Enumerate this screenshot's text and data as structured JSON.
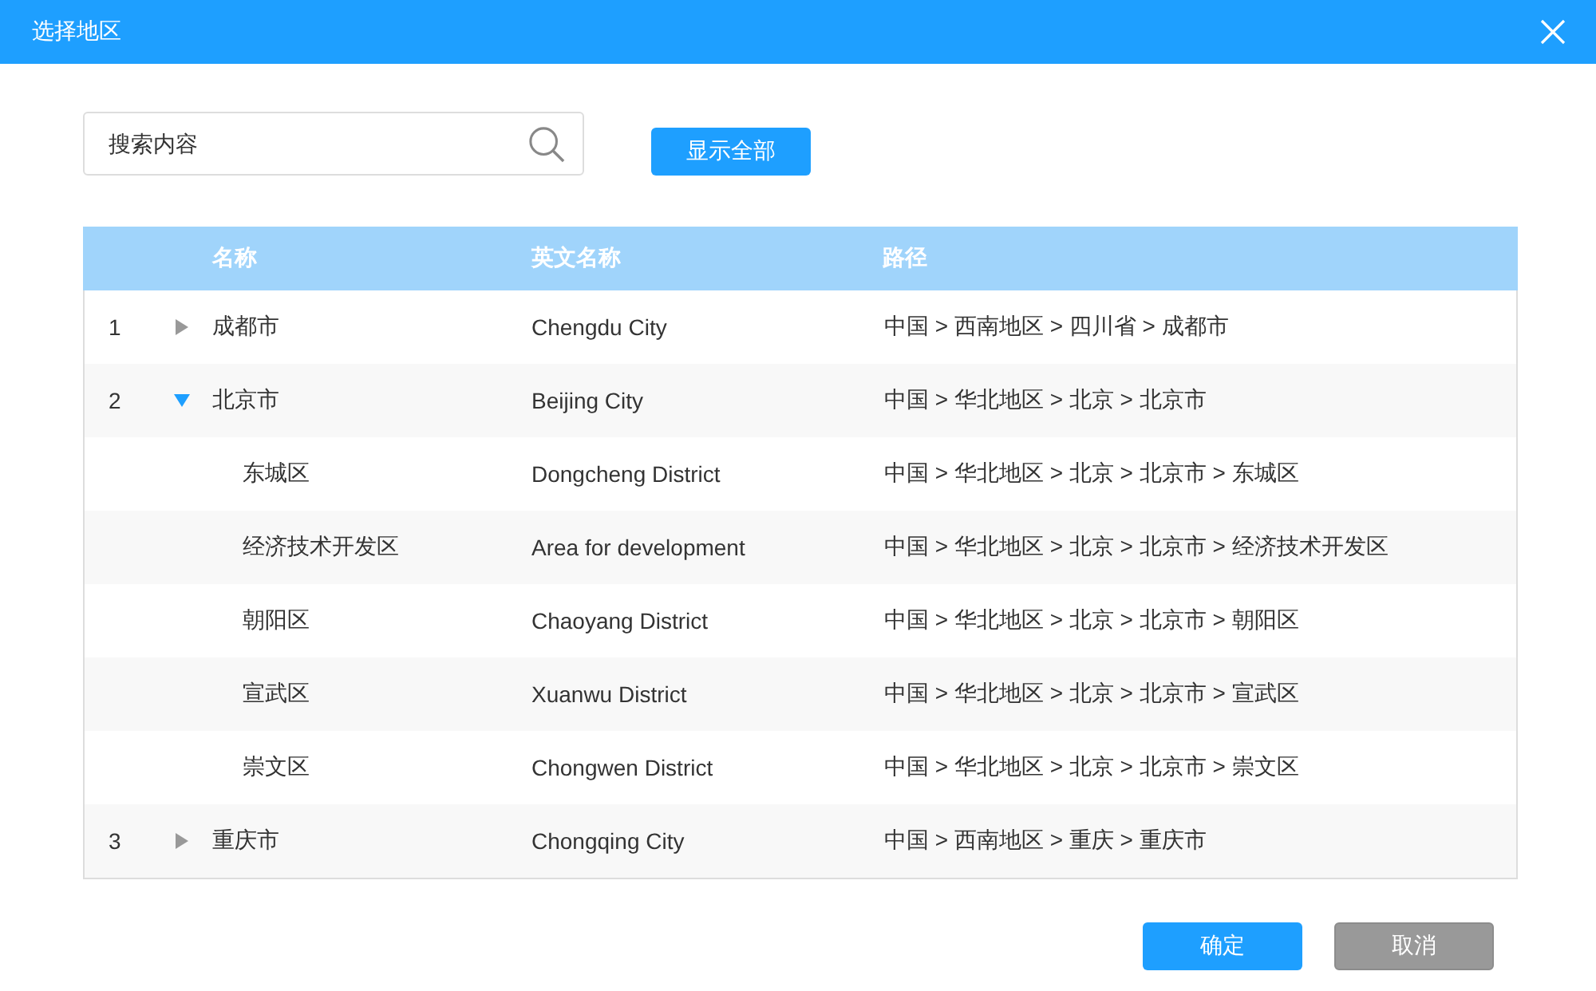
{
  "window": {
    "title": "选择地区"
  },
  "search": {
    "placeholder": "搜索内容"
  },
  "show_all_button": "显示全部",
  "table": {
    "columns": [
      "名称",
      "英文名称",
      "路径"
    ],
    "rows": [
      {
        "index": "1",
        "name": "成都市",
        "english_name": "Chengdu City",
        "path": "中国 > 西南地区 > 四川省 > 成都市",
        "expanded": false
      },
      {
        "index": "2",
        "name": "北京市",
        "english_name": "Beijing City",
        "path": "中国 > 华北地区 > 北京 > 北京市",
        "expanded": true,
        "children": [
          {
            "name": "东城区",
            "english_name": "Dongcheng District",
            "path": "中国 > 华北地区 > 北京 > 北京市 > 东城区"
          },
          {
            "name": "经济技术开发区",
            "english_name": "Area for development",
            "path": "中国 > 华北地区 > 北京 > 北京市 > 经济技术开发区"
          },
          {
            "name": "朝阳区",
            "english_name": "Chaoyang District",
            "path": "中国 > 华北地区 > 北京 > 北京市 > 朝阳区"
          },
          {
            "name": "宣武区",
            "english_name": "Xuanwu District",
            "path": "中国 > 华北地区 > 北京 > 北京市 > 宣武区"
          },
          {
            "name": "崇文区",
            "english_name": "Chongwen District",
            "path": "中国 > 华北地区 > 北京 > 北京市 > 崇文区"
          }
        ]
      },
      {
        "index": "3",
        "name": "重庆市",
        "english_name": "Chongqing City",
        "path": "中国 > 西南地区 > 重庆 > 重庆市",
        "expanded": false
      }
    ]
  },
  "footer_buttons": [
    {
      "label": "确定",
      "kind": "primary"
    },
    {
      "label": "取消",
      "kind": "secondary"
    }
  ]
}
